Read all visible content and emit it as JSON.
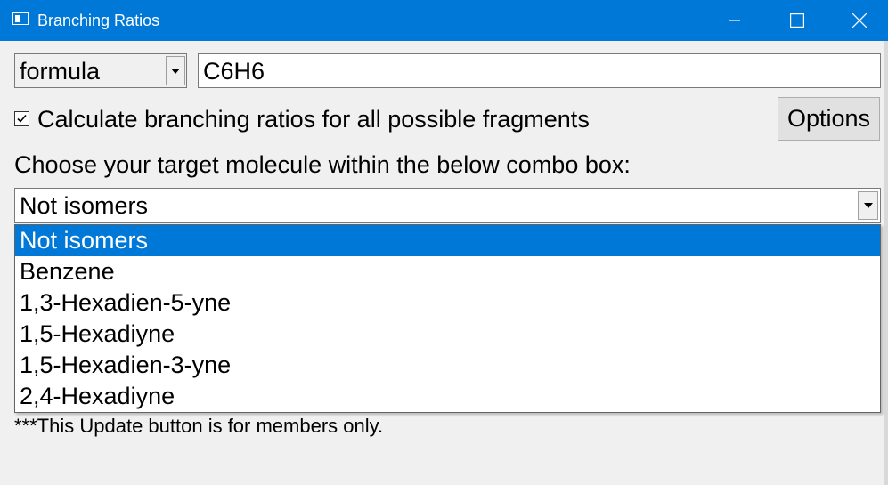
{
  "window": {
    "title": "Branching Ratios",
    "icon": "app-window-icon",
    "controls": {
      "minimize": "minimize-icon",
      "maximize": "maximize-icon",
      "close": "close-icon"
    }
  },
  "search": {
    "type_select": "formula",
    "formula_value": "C6H6"
  },
  "options": {
    "checkbox_label": "Calculate branching ratios for all possible fragments",
    "checkbox_checked": true,
    "button_label": "Options"
  },
  "target": {
    "instruction": "Choose your target molecule within the below combo box:",
    "selected": "Not isomers",
    "items": [
      "Not isomers",
      "Benzene",
      "1,3-Hexadien-5-yne",
      "1,5-Hexadiyne",
      "1,5-Hexadien-3-yne",
      "2,4-Hexadiyne"
    ],
    "highlighted_index": 0
  },
  "footer": {
    "note": "***This Update button is for members only."
  },
  "colors": {
    "accent": "#0078d7",
    "background": "#f0f0f0"
  }
}
